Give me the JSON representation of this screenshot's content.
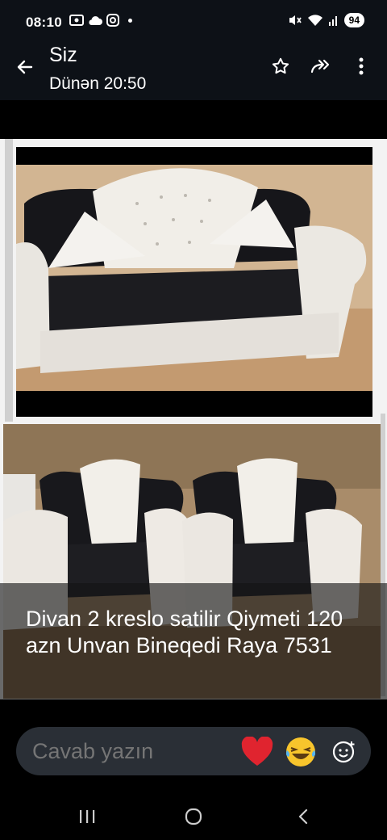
{
  "status": {
    "time": "08:10",
    "battery": "94"
  },
  "header": {
    "title": "Siz",
    "subtitle": "Dünən 20:50"
  },
  "caption": {
    "text": "Divan 2 kreslo satilir Qiymeti 120 azn Unvan Bineqedi Raya 7531"
  },
  "reply": {
    "placeholder": "Cavab yazın"
  },
  "icons": {
    "back": "back-arrow-icon",
    "star": "star-icon",
    "forward": "forward-icon",
    "more": "more-vert-icon",
    "heart": "heart-icon",
    "laugh": "laughing-emoji-icon",
    "emoji_add": "add-emoji-icon"
  },
  "colors": {
    "background": "#000000",
    "bar": "#0d1117",
    "reply_bg": "#2a2f36",
    "heart": "#e0242f"
  }
}
